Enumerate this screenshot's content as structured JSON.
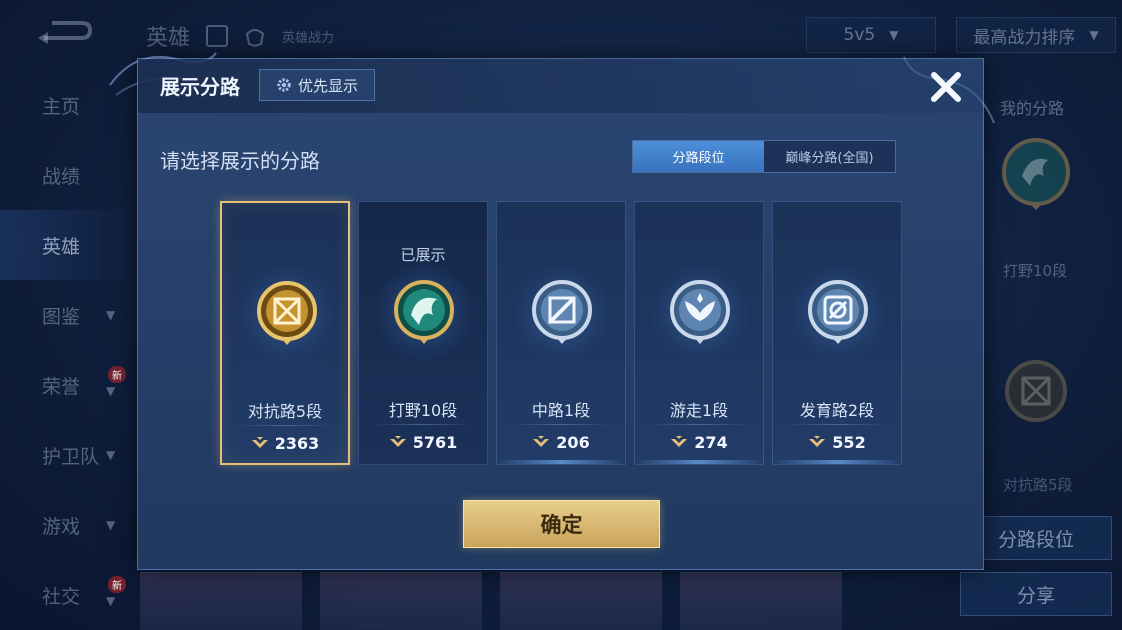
{
  "background": {
    "header": {
      "title": "英雄",
      "subtitle": "英雄战力"
    },
    "mode_select": {
      "value": "5v5"
    },
    "sort_select": {
      "value": "最高战力排序"
    },
    "nav": [
      {
        "label": "主页",
        "badge": ""
      },
      {
        "label": "战绩",
        "badge": ""
      },
      {
        "label": "英雄",
        "badge": ""
      },
      {
        "label": "图鉴",
        "badge": ""
      },
      {
        "label": "荣誉",
        "badge": "新"
      },
      {
        "label": "护卫队",
        "badge": ""
      },
      {
        "label": "游戏",
        "badge": ""
      },
      {
        "label": "社交",
        "badge": "新"
      }
    ],
    "right_panel": {
      "my_lane_label": "我的分路",
      "lane1_label": "打野10段",
      "lane2_label": "对抗路5段",
      "lane_rank_button": "分路段位",
      "share_button": "分享"
    }
  },
  "dialog": {
    "title": "展示分路",
    "priority_button": "优先显示",
    "subtitle": "请选择展示的分路",
    "tabs": [
      {
        "label": "分路段位",
        "active": true
      },
      {
        "label": "巅峰分路(全国)",
        "active": false
      }
    ],
    "lanes": [
      {
        "name": "对抗路5段",
        "score": "2363",
        "shown_label": "",
        "selected": true,
        "emblem": "gold-crossed-swords-emblem"
      },
      {
        "name": "打野10段",
        "score": "5761",
        "shown_label": "已展示",
        "selected": false,
        "emblem": "green-dragon-emblem"
      },
      {
        "name": "中路1段",
        "score": "206",
        "shown_label": "",
        "selected": false,
        "emblem": "silver-slash-emblem"
      },
      {
        "name": "游走1段",
        "score": "274",
        "shown_label": "",
        "selected": false,
        "emblem": "silver-wings-emblem"
      },
      {
        "name": "发育路2段",
        "score": "552",
        "shown_label": "",
        "selected": false,
        "emblem": "silver-target-emblem"
      }
    ],
    "confirm_button": "确定"
  },
  "colors": {
    "accent_gold": "#e6c077",
    "tab_active_blue": "#3873c0",
    "dialog_bg": "#21395f"
  }
}
